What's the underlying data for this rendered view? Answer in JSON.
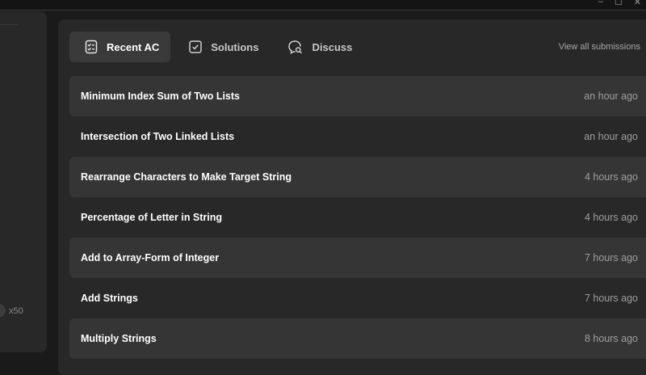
{
  "window_controls": [
    "–",
    "☐",
    "✕"
  ],
  "left_panel": {
    "count_label": "x50"
  },
  "tabs": [
    {
      "label": "Recent AC",
      "icon": "list-check-icon",
      "active": true
    },
    {
      "label": "Solutions",
      "icon": "checkbox-icon",
      "active": false
    },
    {
      "label": "Discuss",
      "icon": "chat-search-icon",
      "active": false
    }
  ],
  "view_all_label": "View all submissions",
  "submissions": [
    {
      "title": "Minimum Index Sum of Two Lists",
      "time": "an hour ago"
    },
    {
      "title": "Intersection of Two Linked Lists",
      "time": "an hour ago"
    },
    {
      "title": "Rearrange Characters to Make Target String",
      "time": "4 hours ago"
    },
    {
      "title": "Percentage of Letter in String",
      "time": "4 hours ago"
    },
    {
      "title": "Add to Array-Form of Integer",
      "time": "7 hours ago"
    },
    {
      "title": "Add Strings",
      "time": "7 hours ago"
    },
    {
      "title": "Multiply Strings",
      "time": "8 hours ago"
    }
  ]
}
